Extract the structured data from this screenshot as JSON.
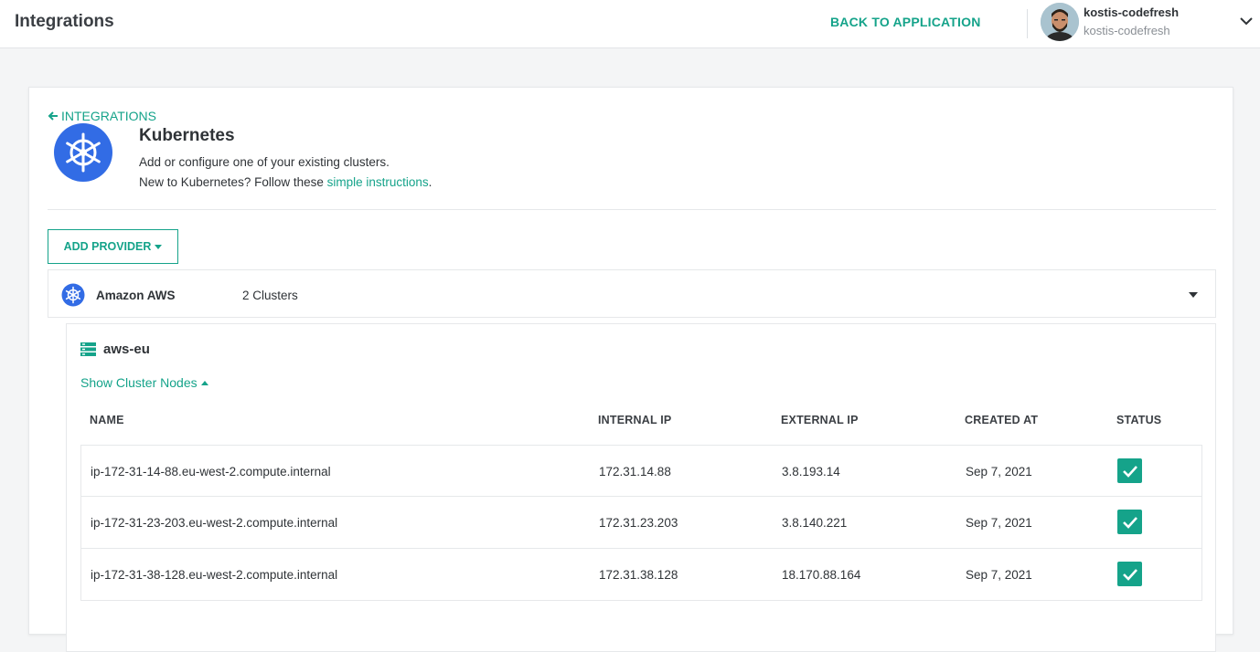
{
  "header": {
    "title": "Integrations",
    "back_label": "BACK TO APPLICATION",
    "user": {
      "name": "kostis-codefresh",
      "account": "kostis-codefresh"
    }
  },
  "breadcrumb": {
    "label": "INTEGRATIONS"
  },
  "integration": {
    "title": "Kubernetes",
    "description": "Add or configure one of your existing clusters.",
    "help_prefix": "New to Kubernetes? Follow these ",
    "help_link": "simple instructions",
    "help_suffix": "."
  },
  "add_provider_label": "ADD PROVIDER",
  "provider": {
    "name": "Amazon AWS",
    "count": "2 Clusters"
  },
  "cluster": {
    "name": "aws-eu",
    "toggle_label": "Show Cluster Nodes",
    "columns": [
      "NAME",
      "INTERNAL IP",
      "EXTERNAL IP",
      "CREATED AT",
      "STATUS"
    ],
    "nodes": [
      {
        "name": "ip-172-31-14-88.eu-west-2.compute.internal",
        "internal_ip": "172.31.14.88",
        "external_ip": "3.8.193.14",
        "created_at": "Sep 7, 2021",
        "status": "ok"
      },
      {
        "name": "ip-172-31-23-203.eu-west-2.compute.internal",
        "internal_ip": "172.31.23.203",
        "external_ip": "3.8.140.221",
        "created_at": "Sep 7, 2021",
        "status": "ok"
      },
      {
        "name": "ip-172-31-38-128.eu-west-2.compute.internal",
        "internal_ip": "172.31.38.128",
        "external_ip": "18.170.88.164",
        "created_at": "Sep 7, 2021",
        "status": "ok"
      }
    ]
  },
  "colors": {
    "accent": "#15a38a",
    "kubernetes_blue": "#326ce5"
  }
}
